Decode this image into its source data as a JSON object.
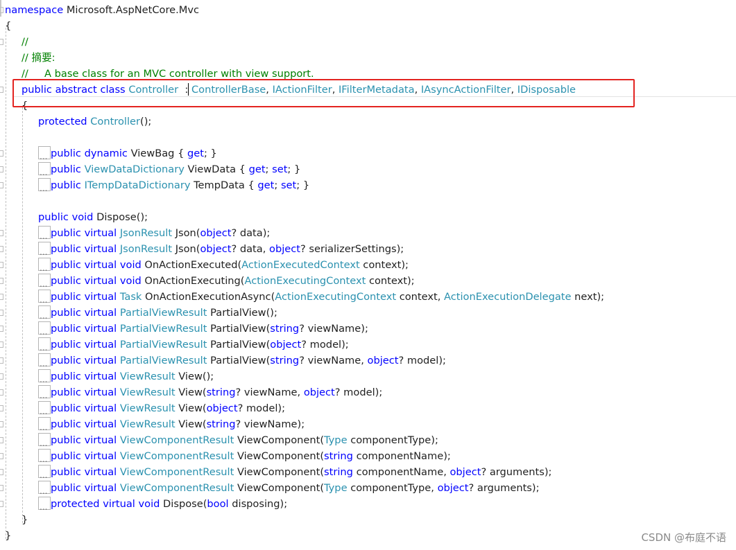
{
  "colors": {
    "keyword": "#0000ff",
    "type": "#2b91af",
    "comment": "#008000",
    "text": "#1f1f1f",
    "highlight_border": "#e32320"
  },
  "code_lines": [
    {
      "indent": 0,
      "fold": true,
      "tokens": [
        {
          "t": "namespace",
          "c": "keyword"
        },
        {
          "t": " Microsoft.AspNetCore.Mvc",
          "c": "text"
        }
      ]
    },
    {
      "indent": 0,
      "tokens": [
        {
          "t": "{",
          "c": "text"
        }
      ]
    },
    {
      "indent": 1,
      "fold": true,
      "tokens": [
        {
          "t": "//",
          "c": "comment"
        }
      ]
    },
    {
      "indent": 1,
      "tokens": [
        {
          "t": "// 摘要:",
          "c": "comment"
        }
      ]
    },
    {
      "indent": 1,
      "tokens": [
        {
          "t": "//     A base class for an MVC controller with view support.",
          "c": "comment"
        }
      ]
    },
    {
      "indent": 1,
      "fold": true,
      "tokens": [
        {
          "t": "public",
          "c": "keyword"
        },
        {
          "t": " ",
          "c": "text"
        },
        {
          "t": "abstract",
          "c": "keyword"
        },
        {
          "t": " ",
          "c": "text"
        },
        {
          "t": "class",
          "c": "keyword"
        },
        {
          "t": " ",
          "c": "text"
        },
        {
          "t": "Controller",
          "c": "type"
        },
        {
          "t": "  : ",
          "c": "text"
        },
        {
          "t": "ControllerBase",
          "c": "type"
        },
        {
          "t": ", ",
          "c": "text"
        },
        {
          "t": "IActionFilter",
          "c": "type"
        },
        {
          "t": ", ",
          "c": "text"
        },
        {
          "t": "IFilterMetadata",
          "c": "type"
        },
        {
          "t": ", ",
          "c": "text"
        },
        {
          "t": "IAsyncActionFilter",
          "c": "type"
        },
        {
          "t": ", ",
          "c": "text"
        },
        {
          "t": "IDisposable",
          "c": "type"
        }
      ]
    },
    {
      "indent": 1,
      "tokens": [
        {
          "t": "{",
          "c": "text"
        }
      ]
    },
    {
      "indent": 2,
      "tokens": [
        {
          "t": "protected",
          "c": "keyword"
        },
        {
          "t": " ",
          "c": "text"
        },
        {
          "t": "Controller",
          "c": "type"
        },
        {
          "t": "();",
          "c": "text"
        }
      ]
    },
    {
      "indent": 2,
      "tokens": []
    },
    {
      "indent": 2,
      "collapsed": true,
      "fold": true,
      "tokens": [
        {
          "t": "public",
          "c": "keyword"
        },
        {
          "t": " ",
          "c": "text"
        },
        {
          "t": "dynamic",
          "c": "keyword"
        },
        {
          "t": " ViewBag { ",
          "c": "text"
        },
        {
          "t": "get",
          "c": "keyword"
        },
        {
          "t": "; }",
          "c": "text"
        }
      ]
    },
    {
      "indent": 2,
      "collapsed": true,
      "fold": true,
      "tokens": [
        {
          "t": "public",
          "c": "keyword"
        },
        {
          "t": " ",
          "c": "text"
        },
        {
          "t": "ViewDataDictionary",
          "c": "type"
        },
        {
          "t": " ViewData { ",
          "c": "text"
        },
        {
          "t": "get",
          "c": "keyword"
        },
        {
          "t": "; ",
          "c": "text"
        },
        {
          "t": "set",
          "c": "keyword"
        },
        {
          "t": "; }",
          "c": "text"
        }
      ]
    },
    {
      "indent": 2,
      "collapsed": true,
      "fold": true,
      "tokens": [
        {
          "t": "public",
          "c": "keyword"
        },
        {
          "t": " ",
          "c": "text"
        },
        {
          "t": "ITempDataDictionary",
          "c": "type"
        },
        {
          "t": " TempData { ",
          "c": "text"
        },
        {
          "t": "get",
          "c": "keyword"
        },
        {
          "t": "; ",
          "c": "text"
        },
        {
          "t": "set",
          "c": "keyword"
        },
        {
          "t": "; }",
          "c": "text"
        }
      ]
    },
    {
      "indent": 2,
      "tokens": []
    },
    {
      "indent": 2,
      "tokens": [
        {
          "t": "public",
          "c": "keyword"
        },
        {
          "t": " ",
          "c": "text"
        },
        {
          "t": "void",
          "c": "keyword"
        },
        {
          "t": " Dispose();",
          "c": "text"
        }
      ]
    },
    {
      "indent": 2,
      "collapsed": true,
      "fold": true,
      "tokens": [
        {
          "t": "public",
          "c": "keyword"
        },
        {
          "t": " ",
          "c": "text"
        },
        {
          "t": "virtual",
          "c": "keyword"
        },
        {
          "t": " ",
          "c": "text"
        },
        {
          "t": "JsonResult",
          "c": "type"
        },
        {
          "t": " Json(",
          "c": "text"
        },
        {
          "t": "object",
          "c": "keyword"
        },
        {
          "t": "? data);",
          "c": "text"
        }
      ]
    },
    {
      "indent": 2,
      "collapsed": true,
      "fold": true,
      "tokens": [
        {
          "t": "public",
          "c": "keyword"
        },
        {
          "t": " ",
          "c": "text"
        },
        {
          "t": "virtual",
          "c": "keyword"
        },
        {
          "t": " ",
          "c": "text"
        },
        {
          "t": "JsonResult",
          "c": "type"
        },
        {
          "t": " Json(",
          "c": "text"
        },
        {
          "t": "object",
          "c": "keyword"
        },
        {
          "t": "? data, ",
          "c": "text"
        },
        {
          "t": "object",
          "c": "keyword"
        },
        {
          "t": "? serializerSettings);",
          "c": "text"
        }
      ]
    },
    {
      "indent": 2,
      "collapsed": true,
      "fold": true,
      "tokens": [
        {
          "t": "public",
          "c": "keyword"
        },
        {
          "t": " ",
          "c": "text"
        },
        {
          "t": "virtual",
          "c": "keyword"
        },
        {
          "t": " ",
          "c": "text"
        },
        {
          "t": "void",
          "c": "keyword"
        },
        {
          "t": " OnActionExecuted(",
          "c": "text"
        },
        {
          "t": "ActionExecutedContext",
          "c": "type"
        },
        {
          "t": " context);",
          "c": "text"
        }
      ]
    },
    {
      "indent": 2,
      "collapsed": true,
      "fold": true,
      "tokens": [
        {
          "t": "public",
          "c": "keyword"
        },
        {
          "t": " ",
          "c": "text"
        },
        {
          "t": "virtual",
          "c": "keyword"
        },
        {
          "t": " ",
          "c": "text"
        },
        {
          "t": "void",
          "c": "keyword"
        },
        {
          "t": " OnActionExecuting(",
          "c": "text"
        },
        {
          "t": "ActionExecutingContext",
          "c": "type"
        },
        {
          "t": " context);",
          "c": "text"
        }
      ]
    },
    {
      "indent": 2,
      "collapsed": true,
      "fold": true,
      "tokens": [
        {
          "t": "public",
          "c": "keyword"
        },
        {
          "t": " ",
          "c": "text"
        },
        {
          "t": "virtual",
          "c": "keyword"
        },
        {
          "t": " ",
          "c": "text"
        },
        {
          "t": "Task",
          "c": "type"
        },
        {
          "t": " OnActionExecutionAsync(",
          "c": "text"
        },
        {
          "t": "ActionExecutingContext",
          "c": "type"
        },
        {
          "t": " context, ",
          "c": "text"
        },
        {
          "t": "ActionExecutionDelegate",
          "c": "type"
        },
        {
          "t": " next);",
          "c": "text"
        }
      ]
    },
    {
      "indent": 2,
      "collapsed": true,
      "fold": true,
      "tokens": [
        {
          "t": "public",
          "c": "keyword"
        },
        {
          "t": " ",
          "c": "text"
        },
        {
          "t": "virtual",
          "c": "keyword"
        },
        {
          "t": " ",
          "c": "text"
        },
        {
          "t": "PartialViewResult",
          "c": "type"
        },
        {
          "t": " PartialView();",
          "c": "text"
        }
      ]
    },
    {
      "indent": 2,
      "collapsed": true,
      "fold": true,
      "tokens": [
        {
          "t": "public",
          "c": "keyword"
        },
        {
          "t": " ",
          "c": "text"
        },
        {
          "t": "virtual",
          "c": "keyword"
        },
        {
          "t": " ",
          "c": "text"
        },
        {
          "t": "PartialViewResult",
          "c": "type"
        },
        {
          "t": " PartialView(",
          "c": "text"
        },
        {
          "t": "string",
          "c": "keyword"
        },
        {
          "t": "? viewName);",
          "c": "text"
        }
      ]
    },
    {
      "indent": 2,
      "collapsed": true,
      "fold": true,
      "tokens": [
        {
          "t": "public",
          "c": "keyword"
        },
        {
          "t": " ",
          "c": "text"
        },
        {
          "t": "virtual",
          "c": "keyword"
        },
        {
          "t": " ",
          "c": "text"
        },
        {
          "t": "PartialViewResult",
          "c": "type"
        },
        {
          "t": " PartialView(",
          "c": "text"
        },
        {
          "t": "object",
          "c": "keyword"
        },
        {
          "t": "? model);",
          "c": "text"
        }
      ]
    },
    {
      "indent": 2,
      "collapsed": true,
      "fold": true,
      "tokens": [
        {
          "t": "public",
          "c": "keyword"
        },
        {
          "t": " ",
          "c": "text"
        },
        {
          "t": "virtual",
          "c": "keyword"
        },
        {
          "t": " ",
          "c": "text"
        },
        {
          "t": "PartialViewResult",
          "c": "type"
        },
        {
          "t": " PartialView(",
          "c": "text"
        },
        {
          "t": "string",
          "c": "keyword"
        },
        {
          "t": "? viewName, ",
          "c": "text"
        },
        {
          "t": "object",
          "c": "keyword"
        },
        {
          "t": "? model);",
          "c": "text"
        }
      ]
    },
    {
      "indent": 2,
      "collapsed": true,
      "fold": true,
      "tokens": [
        {
          "t": "public",
          "c": "keyword"
        },
        {
          "t": " ",
          "c": "text"
        },
        {
          "t": "virtual",
          "c": "keyword"
        },
        {
          "t": " ",
          "c": "text"
        },
        {
          "t": "ViewResult",
          "c": "type"
        },
        {
          "t": " View();",
          "c": "text"
        }
      ]
    },
    {
      "indent": 2,
      "collapsed": true,
      "fold": true,
      "tokens": [
        {
          "t": "public",
          "c": "keyword"
        },
        {
          "t": " ",
          "c": "text"
        },
        {
          "t": "virtual",
          "c": "keyword"
        },
        {
          "t": " ",
          "c": "text"
        },
        {
          "t": "ViewResult",
          "c": "type"
        },
        {
          "t": " View(",
          "c": "text"
        },
        {
          "t": "string",
          "c": "keyword"
        },
        {
          "t": "? viewName, ",
          "c": "text"
        },
        {
          "t": "object",
          "c": "keyword"
        },
        {
          "t": "? model);",
          "c": "text"
        }
      ]
    },
    {
      "indent": 2,
      "collapsed": true,
      "fold": true,
      "tokens": [
        {
          "t": "public",
          "c": "keyword"
        },
        {
          "t": " ",
          "c": "text"
        },
        {
          "t": "virtual",
          "c": "keyword"
        },
        {
          "t": " ",
          "c": "text"
        },
        {
          "t": "ViewResult",
          "c": "type"
        },
        {
          "t": " View(",
          "c": "text"
        },
        {
          "t": "object",
          "c": "keyword"
        },
        {
          "t": "? model);",
          "c": "text"
        }
      ]
    },
    {
      "indent": 2,
      "collapsed": true,
      "fold": true,
      "tokens": [
        {
          "t": "public",
          "c": "keyword"
        },
        {
          "t": " ",
          "c": "text"
        },
        {
          "t": "virtual",
          "c": "keyword"
        },
        {
          "t": " ",
          "c": "text"
        },
        {
          "t": "ViewResult",
          "c": "type"
        },
        {
          "t": " View(",
          "c": "text"
        },
        {
          "t": "string",
          "c": "keyword"
        },
        {
          "t": "? viewName);",
          "c": "text"
        }
      ]
    },
    {
      "indent": 2,
      "collapsed": true,
      "fold": true,
      "tokens": [
        {
          "t": "public",
          "c": "keyword"
        },
        {
          "t": " ",
          "c": "text"
        },
        {
          "t": "virtual",
          "c": "keyword"
        },
        {
          "t": " ",
          "c": "text"
        },
        {
          "t": "ViewComponentResult",
          "c": "type"
        },
        {
          "t": " ViewComponent(",
          "c": "text"
        },
        {
          "t": "Type",
          "c": "type"
        },
        {
          "t": " componentType);",
          "c": "text"
        }
      ]
    },
    {
      "indent": 2,
      "collapsed": true,
      "fold": true,
      "tokens": [
        {
          "t": "public",
          "c": "keyword"
        },
        {
          "t": " ",
          "c": "text"
        },
        {
          "t": "virtual",
          "c": "keyword"
        },
        {
          "t": " ",
          "c": "text"
        },
        {
          "t": "ViewComponentResult",
          "c": "type"
        },
        {
          "t": " ViewComponent(",
          "c": "text"
        },
        {
          "t": "string",
          "c": "keyword"
        },
        {
          "t": " componentName);",
          "c": "text"
        }
      ]
    },
    {
      "indent": 2,
      "collapsed": true,
      "fold": true,
      "tokens": [
        {
          "t": "public",
          "c": "keyword"
        },
        {
          "t": " ",
          "c": "text"
        },
        {
          "t": "virtual",
          "c": "keyword"
        },
        {
          "t": " ",
          "c": "text"
        },
        {
          "t": "ViewComponentResult",
          "c": "type"
        },
        {
          "t": " ViewComponent(",
          "c": "text"
        },
        {
          "t": "string",
          "c": "keyword"
        },
        {
          "t": " componentName, ",
          "c": "text"
        },
        {
          "t": "object",
          "c": "keyword"
        },
        {
          "t": "? arguments);",
          "c": "text"
        }
      ]
    },
    {
      "indent": 2,
      "collapsed": true,
      "fold": true,
      "tokens": [
        {
          "t": "public",
          "c": "keyword"
        },
        {
          "t": " ",
          "c": "text"
        },
        {
          "t": "virtual",
          "c": "keyword"
        },
        {
          "t": " ",
          "c": "text"
        },
        {
          "t": "ViewComponentResult",
          "c": "type"
        },
        {
          "t": " ViewComponent(",
          "c": "text"
        },
        {
          "t": "Type",
          "c": "type"
        },
        {
          "t": " componentType, ",
          "c": "text"
        },
        {
          "t": "object",
          "c": "keyword"
        },
        {
          "t": "? arguments);",
          "c": "text"
        }
      ]
    },
    {
      "indent": 2,
      "collapsed": true,
      "fold": true,
      "tokens": [
        {
          "t": "protected",
          "c": "keyword"
        },
        {
          "t": " ",
          "c": "text"
        },
        {
          "t": "virtual",
          "c": "keyword"
        },
        {
          "t": " ",
          "c": "text"
        },
        {
          "t": "void",
          "c": "keyword"
        },
        {
          "t": " Dispose(",
          "c": "text"
        },
        {
          "t": "bool",
          "c": "keyword"
        },
        {
          "t": " disposing);",
          "c": "text"
        }
      ]
    },
    {
      "indent": 1,
      "tokens": [
        {
          "t": "}",
          "c": "text"
        }
      ]
    },
    {
      "indent": 0,
      "tokens": [
        {
          "t": "}",
          "c": "text"
        }
      ]
    }
  ],
  "collapsed_marker": "...",
  "watermark": "CSDN @布庭不语"
}
